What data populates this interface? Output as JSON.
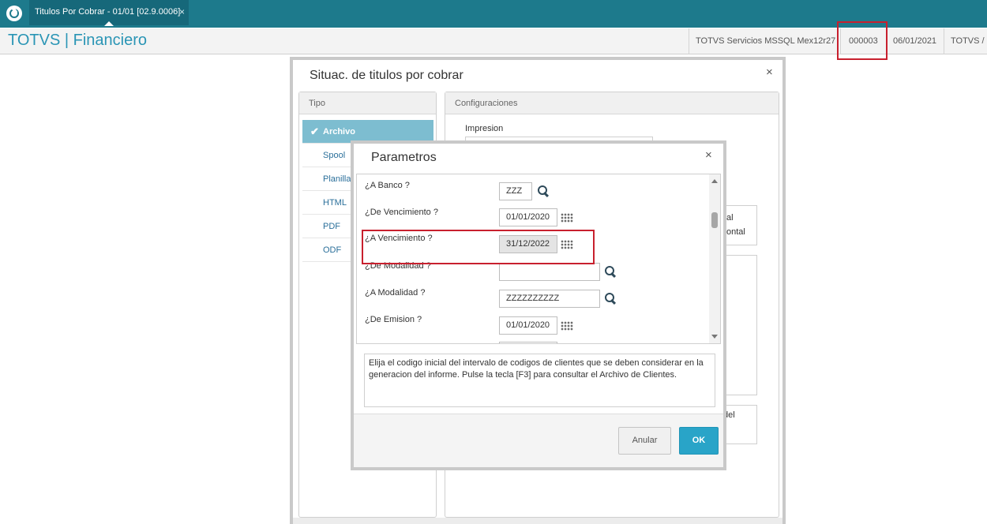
{
  "topbar": {
    "tab_label": "Titulos Por Cobrar - 01/01 [02.9.0006]",
    "tab_close": "×"
  },
  "header": {
    "app_title": "TOTVS | Financiero",
    "server": "TOTVS Servicios MSSQL Mex12r27",
    "code": "000003",
    "date": "06/01/2021",
    "env": "TOTVS / I"
  },
  "dialog_situac": {
    "title": "Situac. de titulos por cobrar",
    "close": "×",
    "tipo_header": "Tipo",
    "tipo_items": [
      "Archivo",
      "Spool",
      "Planilla",
      "HTML",
      "PDF",
      "ODF"
    ],
    "selected_check": "✔",
    "config_header": "Configuraciones",
    "impresion_label": "Impresion",
    "partial_texts": [
      "al",
      "ontal",
      "del"
    ]
  },
  "dialog_params": {
    "title": "Parametros",
    "close": "×",
    "params": [
      {
        "label": "¿A Banco ?",
        "value": "ZZZ"
      },
      {
        "label": "¿De Vencimiento ?",
        "value": "01/01/2020"
      },
      {
        "label": "¿A Vencimiento ?",
        "value": "31/12/2022"
      },
      {
        "label": "¿De Modalidad ?",
        "value": ""
      },
      {
        "label": "¿A Modalidad ?",
        "value": "ZZZZZZZZZZ"
      },
      {
        "label": "¿De Emision ?",
        "value": "01/01/2020"
      }
    ],
    "help_text": "Elija el codigo inicial del intervalo de codigos de clientes que se deben considerar en la generacion del informe. Pulse la tecla [F3] para consultar el Archivo de Clientes.",
    "cancel_label": "Anular",
    "ok_label": "OK"
  },
  "colors": {
    "topbar": "#1d7a8c",
    "accent": "#2a95b5",
    "highlight_border": "#c8202e",
    "ok_button": "#29a4c8",
    "selected_item": "#7dbdd0"
  }
}
